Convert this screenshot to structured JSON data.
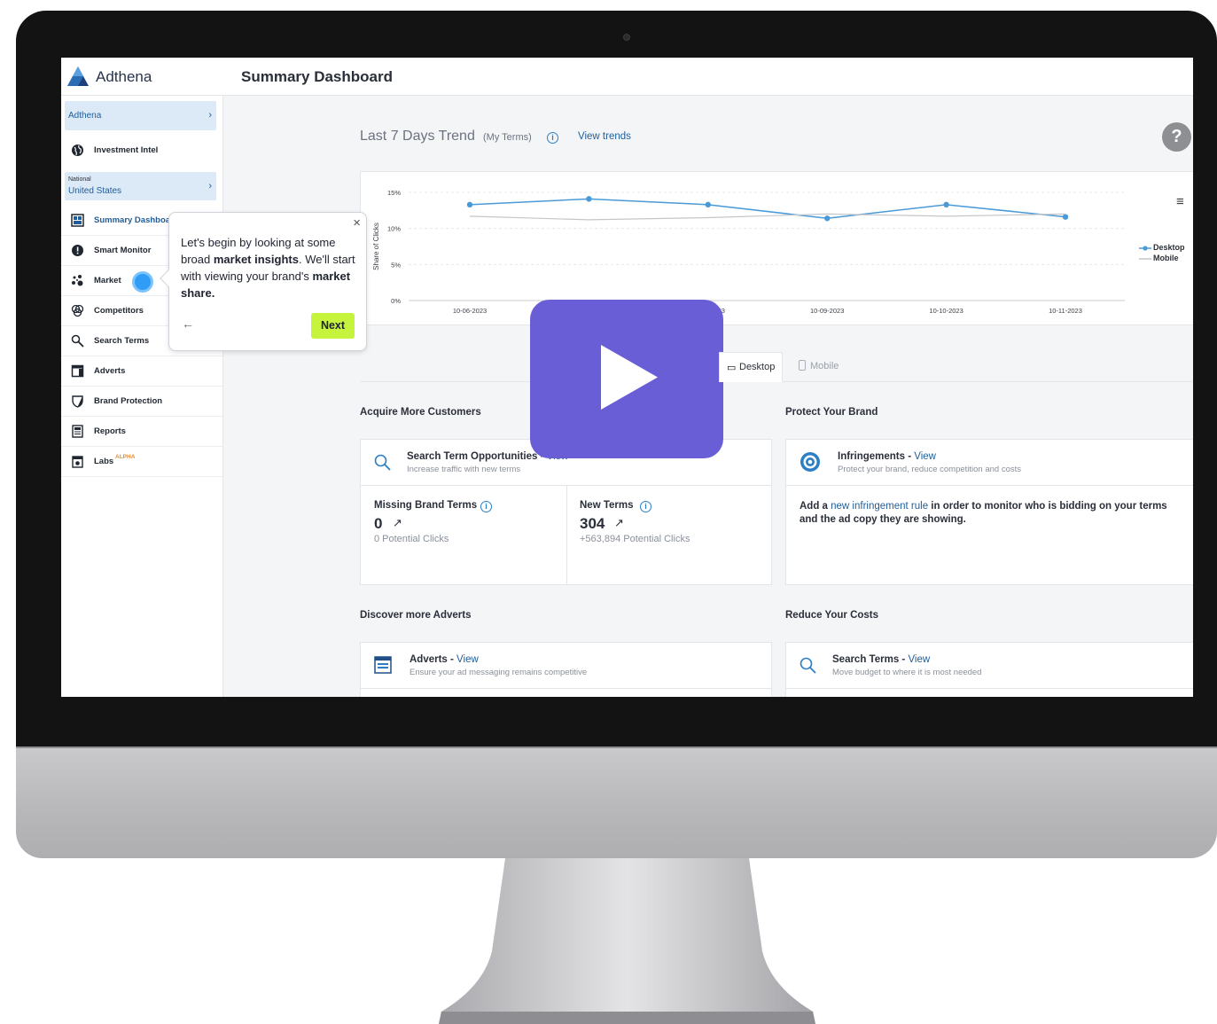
{
  "app": {
    "brand": "Adthena",
    "page_title": "Summary Dashboard"
  },
  "sidebar": {
    "account": {
      "label": "Adthena"
    },
    "investment": {
      "label": "Investment Intel"
    },
    "region": {
      "scope": "National",
      "label": "United States"
    },
    "items": [
      {
        "label": "Summary Dashboard",
        "icon": "grid-icon"
      },
      {
        "label": "Smart Monitor",
        "icon": "alert-icon"
      },
      {
        "label": "Market",
        "icon": "bubbles-icon"
      },
      {
        "label": "Competitors",
        "icon": "circles-icon"
      },
      {
        "label": "Search Terms",
        "icon": "search-icon"
      },
      {
        "label": "Adverts",
        "icon": "advert-icon"
      },
      {
        "label": "Brand Protection",
        "icon": "shield-icon"
      },
      {
        "label": "Reports",
        "icon": "report-icon"
      },
      {
        "label": "Labs",
        "icon": "labs-icon",
        "badge": "ALPHA"
      }
    ],
    "collapse_label": "‹"
  },
  "trend": {
    "title": "Last 7 Days Trend",
    "subtitle": "(My Terms)",
    "link": "View trends"
  },
  "chart_data": {
    "type": "line",
    "ylabel": "Share of Clicks",
    "y_ticks": [
      "15%",
      "10%",
      "5%",
      "0%"
    ],
    "ylim": [
      0,
      15
    ],
    "categories": [
      "10-06-2023",
      "10-07-2023",
      "10-08-2023",
      "10-09-2023",
      "10-10-2023",
      "10-11-2023"
    ],
    "series": [
      {
        "name": "Desktop",
        "values": [
          13.3,
          14.1,
          13.3,
          11.4,
          13.3,
          11.6
        ],
        "color": "#4a9ad8"
      },
      {
        "name": "Mobile",
        "values": [
          11.7,
          11.2,
          11.5,
          12.0,
          11.7,
          12.0
        ],
        "color": "#c4c6ca"
      }
    ],
    "legend_position": "right"
  },
  "tabs": [
    {
      "label": "Desktop",
      "active": true
    },
    {
      "label": "Mobile",
      "active": false
    }
  ],
  "sections": {
    "acquire": "Acquire More Customers",
    "protect": "Protect Your Brand",
    "discover": "Discover more Adverts",
    "reduce": "Reduce Your Costs"
  },
  "opportunities": {
    "title": "Search Term Opportunities - ",
    "link": "View",
    "subtitle": "Increase traffic with new terms",
    "missing": {
      "label": "Missing Brand Terms",
      "value": "0",
      "note": "0 Potential Clicks"
    },
    "newterms": {
      "label": "New Terms",
      "value": "304",
      "note": "+563,894 Potential Clicks"
    }
  },
  "infringements": {
    "title": "Infringements - ",
    "link": "View",
    "subtitle": "Protect your brand, reduce competition and costs",
    "body_pre": "Add a ",
    "body_link": "new infringement rule",
    "body_post": " in order to monitor who is bidding on your terms and the ad copy they are showing."
  },
  "adverts": {
    "title": "Adverts - ",
    "link": "View",
    "subtitle": "Ensure your ad messaging remains competitive"
  },
  "searchterms": {
    "title": "Search Terms - ",
    "link": "View",
    "subtitle": "Move budget to where it is most needed"
  },
  "tooltip": {
    "t1": "Let's begin by looking at some broad ",
    "b1": "market insights",
    "t2": ". We'll start with viewing your brand's ",
    "b2": "market share.",
    "close": "×",
    "back": "←",
    "next": "Next"
  },
  "colors": {
    "accent": "#1f5d9a",
    "play": "#6a5ed6",
    "next": "#c6f43c",
    "desktop_line": "#4a9ad8"
  }
}
